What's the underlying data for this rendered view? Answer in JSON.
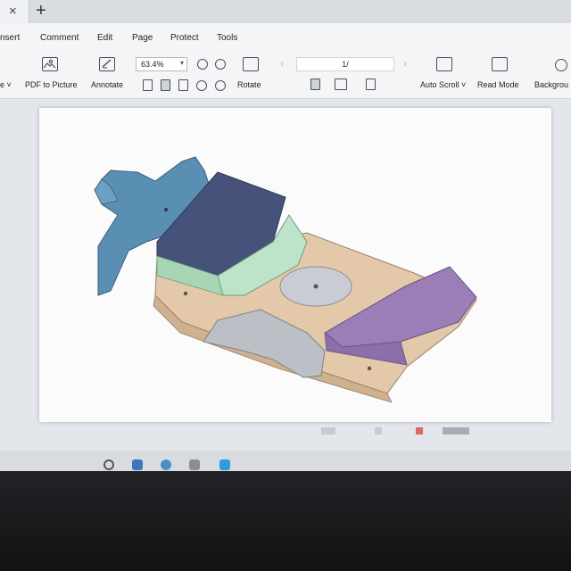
{
  "tabs": {
    "close_glyph": "×",
    "new_glyph": "+"
  },
  "menu": [
    "nsert",
    "Comment",
    "Edit",
    "Page",
    "Protect",
    "Tools"
  ],
  "toolbar": {
    "left_cut": "e ˅",
    "pdf_to_picture": "PDF to Picture",
    "annotate": "Annotate",
    "zoom_value": "63.4%",
    "zoom_arrow": "▾",
    "rotate": "Rotate",
    "page_number": "1/",
    "nav_prev": "‹",
    "nav_next": "›",
    "auto_scroll": "Auto Scroll ˅",
    "read_mode": "Read Mode",
    "background": "Backgrou"
  },
  "icons": [
    "close-icon",
    "new-tab-icon",
    "picture-icon",
    "annotate-icon",
    "zoom-out-icon",
    "zoom-in-icon",
    "rotate-icon",
    "auto-scroll-icon",
    "read-mode-icon",
    "background-icon"
  ],
  "colors": {
    "blue_part": "#5a8fb4",
    "navy_part": "#46527a",
    "green_part": "#bde3c8",
    "beige_part": "#e3c8a9",
    "purple_part": "#9a7eb5",
    "gray_part": "#bcc0c6"
  }
}
